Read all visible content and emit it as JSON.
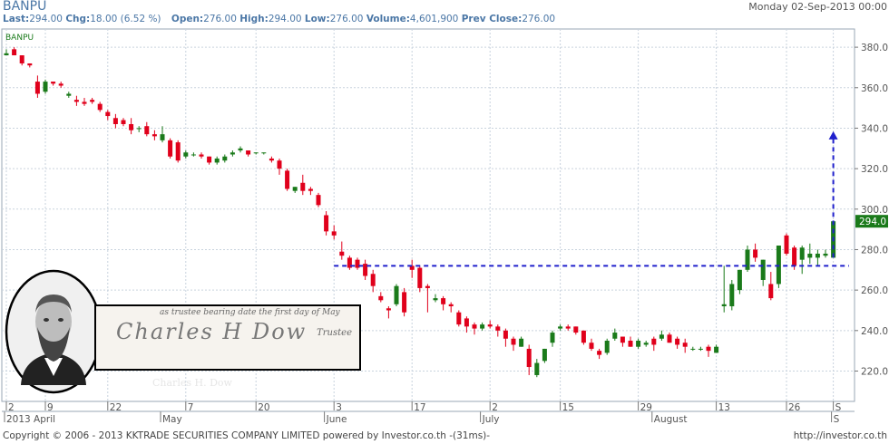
{
  "header": {
    "symbol": "BANPU",
    "date": "Monday 02-Sep-2013 00:00",
    "last_label": "Last:",
    "last": "294.00",
    "chg_label": "Chg:",
    "chg": "18.00 (6.52 %)",
    "open_label": "Open:",
    "open": "276.00",
    "high_label": "High:",
    "high": "294.00",
    "low_label": "Low:",
    "low": "276.00",
    "volume_label": "Volume:",
    "volume": "4,601,900",
    "prev_label": "Prev Close:",
    "prev": "276.00"
  },
  "footer": {
    "copyright": "Copyright © 2006 - 2013 KKTRADE SECURITIES COMPANY LIMITED powered by Investor.co.th -(31ms)-",
    "url": "http://investor.co.th"
  },
  "overlay": {
    "sig_top": "as trustee bearing date the first day of May",
    "sig_name": "Charles H Dow",
    "sig_trustee": "Trustee",
    "caption": "Charles H. Dow"
  },
  "colors": {
    "up": "#1a7a1a",
    "down": "#e0001b",
    "trend": "#2020cc",
    "grid": "#c9d3de",
    "price_tag": "#1a7a1a"
  },
  "chart_data": {
    "type": "candlestick",
    "title": "BANPU",
    "ylim": [
      205,
      389
    ],
    "y_ticks": [
      220,
      240,
      260,
      280,
      300,
      320,
      340,
      360,
      380
    ],
    "y_tick_labels": [
      "220.0",
      "240.0",
      "260.0",
      "280.0",
      "300.0",
      "320.0",
      "340.0",
      "360.0",
      "380.0"
    ],
    "grid": true,
    "last_price_label": "294.0",
    "x_labels": [
      {
        "text": "2",
        "bar": 0
      },
      {
        "text": "9",
        "bar": 5
      },
      {
        "text": "22",
        "bar": 13
      },
      {
        "text": "7",
        "bar": 23
      },
      {
        "text": "20",
        "bar": 32
      },
      {
        "text": "3",
        "bar": 42
      },
      {
        "text": "17",
        "bar": 52
      },
      {
        "text": "2",
        "bar": 62
      },
      {
        "text": "15",
        "bar": 71
      },
      {
        "text": "29",
        "bar": 81
      },
      {
        "text": "13",
        "bar": 91
      },
      {
        "text": "26",
        "bar": 100
      },
      {
        "text": "S",
        "bar": 106
      }
    ],
    "month_labels": [
      {
        "text": "2013 April",
        "bar": 0
      },
      {
        "text": "May",
        "bar": 20
      },
      {
        "text": "June",
        "bar": 41
      },
      {
        "text": "July",
        "bar": 61
      },
      {
        "text": "August",
        "bar": 83
      },
      {
        "text": "S",
        "bar": 106
      }
    ],
    "candles": [
      [
        376,
        379,
        376,
        377
      ],
      [
        379,
        380,
        376,
        376
      ],
      [
        376,
        376,
        371,
        372
      ],
      [
        372,
        372,
        370,
        371
      ],
      [
        363,
        366,
        355,
        357
      ],
      [
        358,
        364,
        357,
        363
      ],
      [
        363,
        363,
        361,
        362
      ],
      [
        362,
        363,
        360,
        361
      ],
      [
        356,
        358,
        355,
        357
      ],
      [
        354,
        356,
        351,
        353
      ],
      [
        353,
        355,
        351,
        352
      ],
      [
        354,
        355,
        352,
        353
      ],
      [
        352,
        353,
        348,
        349
      ],
      [
        348,
        349,
        344,
        346
      ],
      [
        345,
        347,
        340,
        342
      ],
      [
        344,
        345,
        341,
        342
      ],
      [
        342,
        345,
        337,
        339
      ],
      [
        340,
        341,
        338,
        340
      ],
      [
        341,
        343,
        336,
        337
      ],
      [
        337,
        339,
        334,
        336
      ],
      [
        334,
        341,
        333,
        337
      ],
      [
        334,
        335,
        325,
        326
      ],
      [
        333,
        334,
        323,
        324
      ],
      [
        326,
        329,
        325,
        328
      ],
      [
        327,
        328,
        326,
        327
      ],
      [
        327,
        328,
        325,
        326
      ],
      [
        326,
        326,
        322,
        323
      ],
      [
        323,
        326,
        322,
        325
      ],
      [
        324,
        327,
        323,
        326
      ],
      [
        327,
        329,
        326,
        328
      ],
      [
        329,
        331,
        328,
        330
      ],
      [
        329,
        329,
        326,
        327
      ],
      [
        328,
        328,
        327,
        328
      ],
      [
        328,
        328,
        327,
        328
      ],
      [
        325,
        326,
        323,
        324
      ],
      [
        324,
        325,
        317,
        320
      ],
      [
        319,
        320,
        309,
        310
      ],
      [
        309,
        311,
        308,
        311
      ],
      [
        313,
        317,
        307,
        309
      ],
      [
        310,
        311,
        307,
        309
      ],
      [
        307,
        308,
        301,
        302
      ],
      [
        297,
        299,
        287,
        289
      ],
      [
        289,
        292,
        285,
        287
      ],
      [
        279,
        284,
        275,
        277
      ],
      [
        276,
        277,
        270,
        271
      ],
      [
        275,
        276,
        270,
        271
      ],
      [
        273,
        275,
        265,
        267
      ],
      [
        268,
        270,
        259,
        262
      ],
      [
        257,
        259,
        254,
        255
      ],
      [
        251,
        252,
        246,
        250
      ],
      [
        253,
        263,
        252,
        262
      ],
      [
        259,
        261,
        247,
        249
      ],
      [
        272,
        275,
        266,
        270
      ],
      [
        271,
        272,
        259,
        261
      ],
      [
        262,
        263,
        249,
        261
      ],
      [
        255,
        258,
        254,
        256
      ],
      [
        256,
        257,
        250,
        253
      ],
      [
        253,
        254,
        249,
        252
      ],
      [
        249,
        250,
        242,
        243
      ],
      [
        246,
        247,
        239,
        242
      ],
      [
        243,
        244,
        238,
        241
      ],
      [
        241,
        244,
        240,
        243
      ],
      [
        243,
        245,
        241,
        242
      ],
      [
        242,
        243,
        237,
        240
      ],
      [
        240,
        241,
        232,
        236
      ],
      [
        236,
        237,
        230,
        233
      ],
      [
        232,
        237,
        232,
        236
      ],
      [
        231,
        233,
        218,
        222
      ],
      [
        218,
        226,
        217,
        224
      ],
      [
        225,
        231,
        224,
        231
      ],
      [
        234,
        240,
        232,
        239
      ],
      [
        241,
        243,
        240,
        242
      ],
      [
        242,
        243,
        240,
        241
      ],
      [
        242,
        242,
        238,
        239
      ],
      [
        240,
        240,
        233,
        234
      ],
      [
        234,
        236,
        230,
        231
      ],
      [
        230,
        231,
        226,
        228
      ],
      [
        229,
        236,
        228,
        235
      ],
      [
        236,
        241,
        235,
        239
      ],
      [
        237,
        237,
        232,
        234
      ],
      [
        235,
        237,
        232,
        232
      ],
      [
        232,
        236,
        231,
        235
      ],
      [
        233,
        235,
        232,
        234
      ],
      [
        236,
        237,
        230,
        233
      ],
      [
        236,
        240,
        235,
        238
      ],
      [
        238,
        239,
        234,
        234
      ],
      [
        236,
        237,
        231,
        233
      ],
      [
        234,
        236,
        229,
        232
      ],
      [
        231,
        232,
        230,
        231
      ],
      [
        231,
        232,
        230,
        231
      ],
      [
        232,
        233,
        227,
        230
      ],
      [
        229,
        233,
        229,
        232
      ],
      [
        252,
        272,
        249,
        253
      ],
      [
        252,
        265,
        250,
        263
      ],
      [
        260,
        270,
        258,
        270
      ],
      [
        270,
        282,
        269,
        280
      ],
      [
        280,
        283,
        274,
        276
      ],
      [
        265,
        275,
        262,
        275
      ],
      [
        263,
        269,
        255,
        256
      ],
      [
        263,
        281,
        261,
        282
      ],
      [
        287,
        288,
        277,
        278
      ],
      [
        281,
        282,
        270,
        272
      ],
      [
        275,
        282,
        268,
        281
      ],
      [
        276,
        283,
        273,
        278
      ],
      [
        276,
        280,
        272,
        278
      ],
      [
        277,
        280,
        276,
        278
      ],
      [
        276,
        294,
        276,
        294
      ]
    ],
    "trend_line": {
      "y": 272,
      "from_bar": 42,
      "to_bar": 106
    },
    "target_arrow": {
      "bar": 106,
      "from": 276,
      "to": 338
    }
  }
}
